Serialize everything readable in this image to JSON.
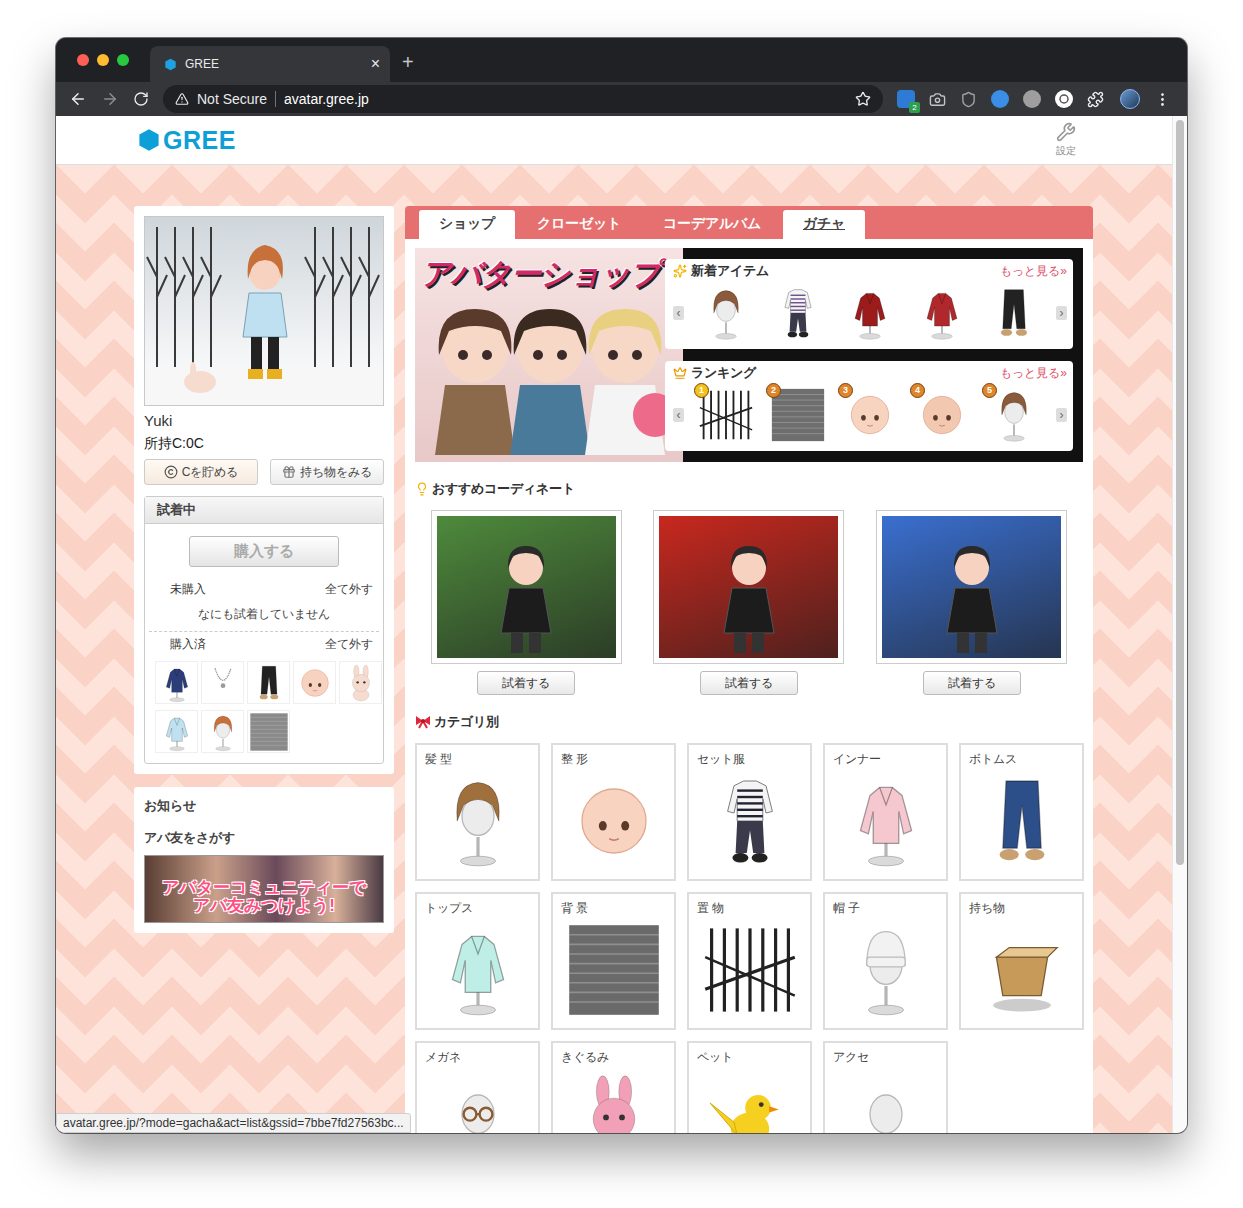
{
  "browser": {
    "traffic_lights": [
      {
        "color": "#ff5f57"
      },
      {
        "color": "#febc2e"
      },
      {
        "color": "#28c840"
      }
    ],
    "tab": {
      "title": "GREE",
      "close": "×",
      "selected": true
    },
    "new_tab": "+",
    "address": {
      "security": "Not Secure",
      "url": "avatar.gree.jp",
      "bookmarked": false
    },
    "extensions": [
      {
        "kind": "square",
        "color": "#2e7bd6",
        "badge": "2"
      },
      {
        "kind": "camera",
        "color": "#c4c4c4"
      },
      {
        "kind": "shield",
        "color": "#a0a0a0"
      },
      {
        "kind": "circle",
        "color": "#3a8ee6"
      },
      {
        "kind": "circle",
        "color": "#9e9e9e"
      },
      {
        "kind": "pin",
        "color": "#ffffff"
      },
      {
        "kind": "puzzle",
        "color": "#e8eaed"
      }
    ],
    "status_link": "avatar.gree.jp/?mode=gacha&act=list&gssid=7bbe7fd27563bc..."
  },
  "header": {
    "logo": "GREE",
    "settings": "設定"
  },
  "profile": {
    "name": "Yuki",
    "coins": "所持C:0C",
    "buttons": [
      {
        "label": "Cを貯める",
        "kind": "coin"
      },
      {
        "label": "持ち物をみる",
        "kind": "bag"
      }
    ]
  },
  "trial": {
    "title": "試着中",
    "purchase": {
      "label": "購入する",
      "disabled": true
    },
    "unpurchased": {
      "label": "未購入",
      "clear": "全て外す",
      "empty": "なにも試着していません"
    },
    "purchased": {
      "label": "購入済",
      "clear": "全て外す",
      "items": [
        {
          "kind": "top",
          "color": "#2c3e7a"
        },
        {
          "kind": "necklace",
          "color": "#9a9a9a"
        },
        {
          "kind": "bottom",
          "color": "#222222"
        },
        {
          "kind": "head",
          "color": "#f7d2c0"
        },
        {
          "kind": "costume",
          "color": "#f6dccf"
        },
        {
          "kind": "top",
          "color": "#bfe0f0"
        },
        {
          "kind": "hair",
          "color": "#c8703a"
        },
        {
          "kind": "background",
          "color": "#8a8a8a"
        }
      ]
    }
  },
  "notice": {
    "title": "お知らせ",
    "link": "アバ友をさがす",
    "banner": [
      "アバターコミュニティーで",
      "アバ友みつけよう!"
    ]
  },
  "tabs": [
    {
      "label": "ショップ",
      "selected": true,
      "hovered": false
    },
    {
      "label": "クローゼット",
      "selected": false,
      "hovered": false
    },
    {
      "label": "コーデアルバム",
      "selected": false,
      "hovered": false
    },
    {
      "label": "ガチャ",
      "selected": false,
      "hovered": true
    }
  ],
  "shop": {
    "logo": "アバターショップ",
    "new_items": {
      "title": "新着アイテム",
      "more": "もっと見る»",
      "prev": "‹",
      "next": "›",
      "items": [
        {
          "kind": "hair",
          "color": "#8b5a3c"
        },
        {
          "kind": "set",
          "color": "#6a4c8a"
        },
        {
          "kind": "top",
          "color": "#9c1c1c"
        },
        {
          "kind": "top",
          "color": "#b0282c"
        },
        {
          "kind": "bottom",
          "color": "#222222"
        }
      ]
    },
    "ranking": {
      "title": "ランキング",
      "more": "もっと見る»",
      "prev": "‹",
      "next": "›",
      "items": [
        {
          "rank": "1",
          "kind": "object",
          "color": "#222222"
        },
        {
          "rank": "2",
          "kind": "background",
          "color": "#6e6e6e"
        },
        {
          "rank": "3",
          "kind": "head",
          "color": "#f7d4c0"
        },
        {
          "rank": "4",
          "kind": "head",
          "color": "#f2c8b0"
        },
        {
          "rank": "5",
          "kind": "hair",
          "color": "#8b5a3c"
        }
      ]
    }
  },
  "coordinates": {
    "title": "おすすめコーディネート",
    "items": [
      {
        "button": "試着する",
        "color": "#4e8a3c"
      },
      {
        "button": "試着する",
        "color": "#c8281e"
      },
      {
        "button": "試着する",
        "color": "#3a6fd0"
      }
    ]
  },
  "categories": {
    "title": "カテゴリ別",
    "items": [
      {
        "label": "髪 型",
        "kind": "hair",
        "color": "#a0703c"
      },
      {
        "label": "整 形",
        "kind": "head",
        "color": "#f8d4c0"
      },
      {
        "label": "セット服",
        "kind": "set",
        "color": "#222233"
      },
      {
        "label": "インナー",
        "kind": "top",
        "color": "#f5c8d0"
      },
      {
        "label": "ボトムス",
        "kind": "bottom",
        "color": "#2c4f8a"
      },
      {
        "label": "トップス",
        "kind": "top",
        "color": "#bfeee6"
      },
      {
        "label": "背 景",
        "kind": "background",
        "color": "#6a6a6a"
      },
      {
        "label": "置 物",
        "kind": "object",
        "color": "#222222"
      },
      {
        "label": "帽 子",
        "kind": "hat",
        "color": "#f2f2f2"
      },
      {
        "label": "持ち物",
        "kind": "bag",
        "color": "#c89a5a"
      },
      {
        "label": "メガネ",
        "kind": "glasses",
        "color": "#8a5a30"
      },
      {
        "label": "きぐるみ",
        "kind": "costume",
        "color": "#f2a0b8"
      },
      {
        "label": "ペット",
        "kind": "pet",
        "color": "#f5d020"
      },
      {
        "label": "アクセ",
        "kind": "accessory",
        "color": "#d0d0d0"
      }
    ]
  }
}
